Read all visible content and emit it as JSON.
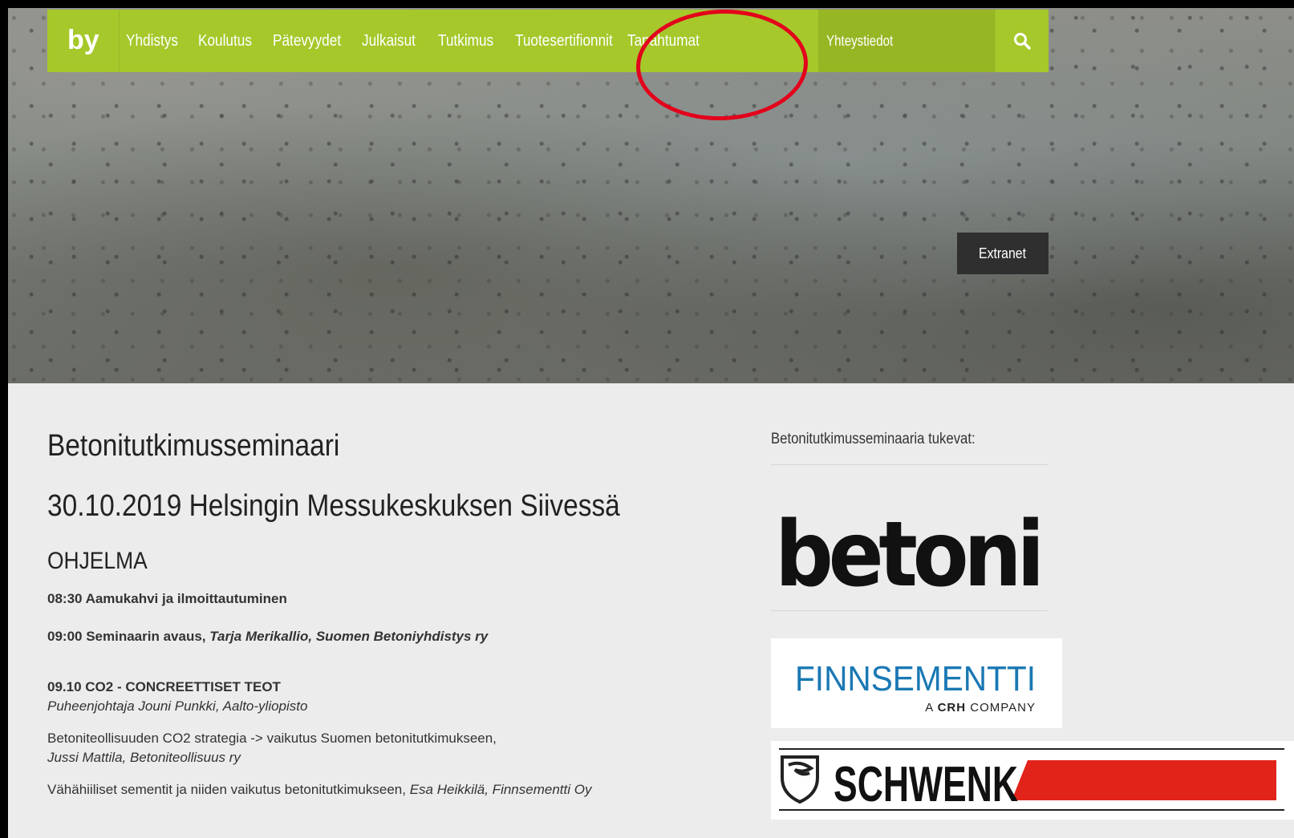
{
  "nav": {
    "items": [
      "Yhdistys",
      "Koulutus",
      "Pätevyydet",
      "Julkaisut",
      "Tutkimus",
      "Tuotesertifionnit",
      "Tapahtumat"
    ],
    "contact": "Yhteystiedot",
    "search_icon": "search-icon",
    "logo_text": "by",
    "accent": "#a6c82b"
  },
  "hero": {
    "extranet_label": "Extranet"
  },
  "article": {
    "title": "Betonitutkimusseminaari",
    "subtitle": "30.10.2019 Helsingin Messukeskuksen Siivessä",
    "section": "OHJELMA",
    "program": {
      "item1": "08:30 Aamukahvi ja ilmoittautuminen",
      "item2_prefix": "09:00 Seminaarin avaus, ",
      "item2_speaker": "Tarja Merikallio, Suomen Betoniyhdistys ry",
      "item3_title": "09.10 CO2 - CONCREETTISET TEOT",
      "item3_chair": "Puheenjohtaja Jouni Punkki, Aalto-yliopisto",
      "item4_title": "Betoniteollisuuden CO2 strategia -> vaikutus Suomen betonitutkimukseen,",
      "item4_speaker": "Jussi Mattila, Betoniteollisuus ry",
      "item5_title": "Vähähiiliset sementit ja niiden vaikutus betonitutkimukseen, ",
      "item5_speaker": "Esa Heikkilä, Finnsementti Oy"
    }
  },
  "sidebar": {
    "title": "Betonitutkimusseminaaria tukevat:",
    "sponsors": {
      "betoni": "betoni",
      "finnsementti": "FINNSEMENTTI",
      "finnsementti_sub_prefix": "A ",
      "finnsementti_sub_crh": "CRH",
      "finnsementti_sub_suffix": " COMPANY",
      "schwenk": "SCHWENK"
    }
  },
  "colors": {
    "annotation": "#e3001b",
    "schwenk_red": "#e2231a",
    "finn_blue": "#1a78b4"
  }
}
